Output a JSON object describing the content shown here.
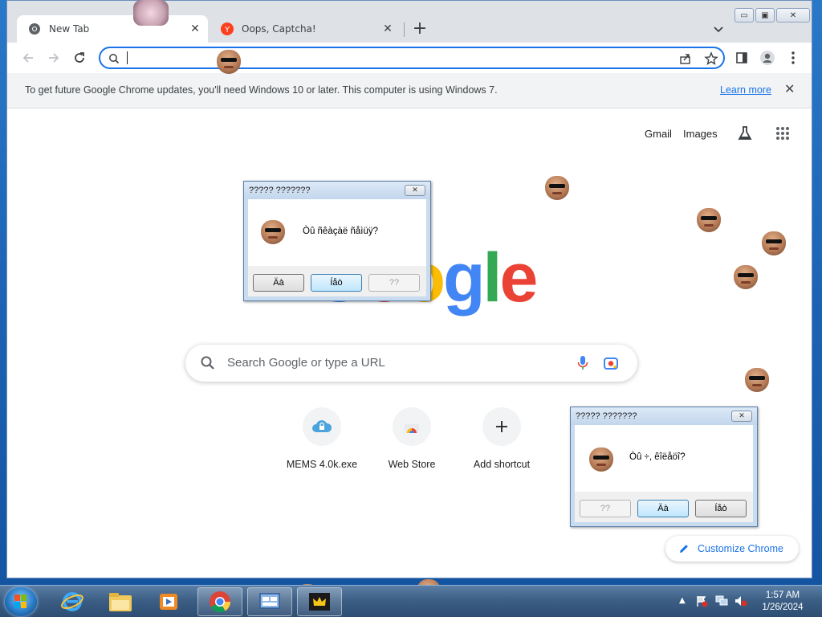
{
  "browser": {
    "tabs": [
      {
        "label": "New Tab",
        "active": true,
        "icon": "chrome-icon"
      },
      {
        "label": "Oops, Captcha!",
        "active": false,
        "icon": "yandex-icon"
      }
    ],
    "omnibox": {
      "value": "",
      "placeholder": ""
    },
    "infobar": {
      "message": "To get future Google Chrome updates, you'll need Windows 10 or later. This computer is using Windows 7.",
      "link": "Learn more"
    },
    "window_controls": {
      "minimize": "▭",
      "maximize": "▣",
      "close": "✕"
    }
  },
  "ntp": {
    "top_links": {
      "gmail": "Gmail",
      "images": "Images"
    },
    "logo_visible": "ogle",
    "search_placeholder": "Search Google or type a URL",
    "shortcuts": [
      {
        "label": "MEMS 4.0k.exe",
        "icon": "cloud-lock-icon"
      },
      {
        "label": "Web Store",
        "icon": "web-store-icon"
      },
      {
        "label": "Add shortcut",
        "icon": "plus-icon"
      }
    ],
    "customize": "Customize Chrome"
  },
  "dialogs": [
    {
      "title": "????? ???????",
      "message": "Òû ñêàçàë ñåìüÿ?",
      "buttons": [
        {
          "label": "Äà",
          "state": "normal"
        },
        {
          "label": "Íåò",
          "state": "default"
        },
        {
          "label": "??",
          "state": "disabled"
        }
      ]
    },
    {
      "title": "????? ???????",
      "message": "Òû ÷, êîëåöî?",
      "buttons": [
        {
          "label": "??",
          "state": "disabled"
        },
        {
          "label": "Äà",
          "state": "default"
        },
        {
          "label": "Íåò",
          "state": "normal"
        }
      ]
    }
  ],
  "taskbar": {
    "items": [
      "internet-explorer-icon",
      "file-explorer-icon",
      "media-player-icon",
      "chrome-icon",
      "app-window-icon",
      "crown-app-icon"
    ],
    "clock_time": "1:57 AM",
    "clock_date": "1/26/2024"
  },
  "colors": {
    "accent": "#1a73e8",
    "g_blue": "#4285f4",
    "g_red": "#ea4335",
    "g_green": "#34a853",
    "g_yellow": "#fbbc05"
  }
}
